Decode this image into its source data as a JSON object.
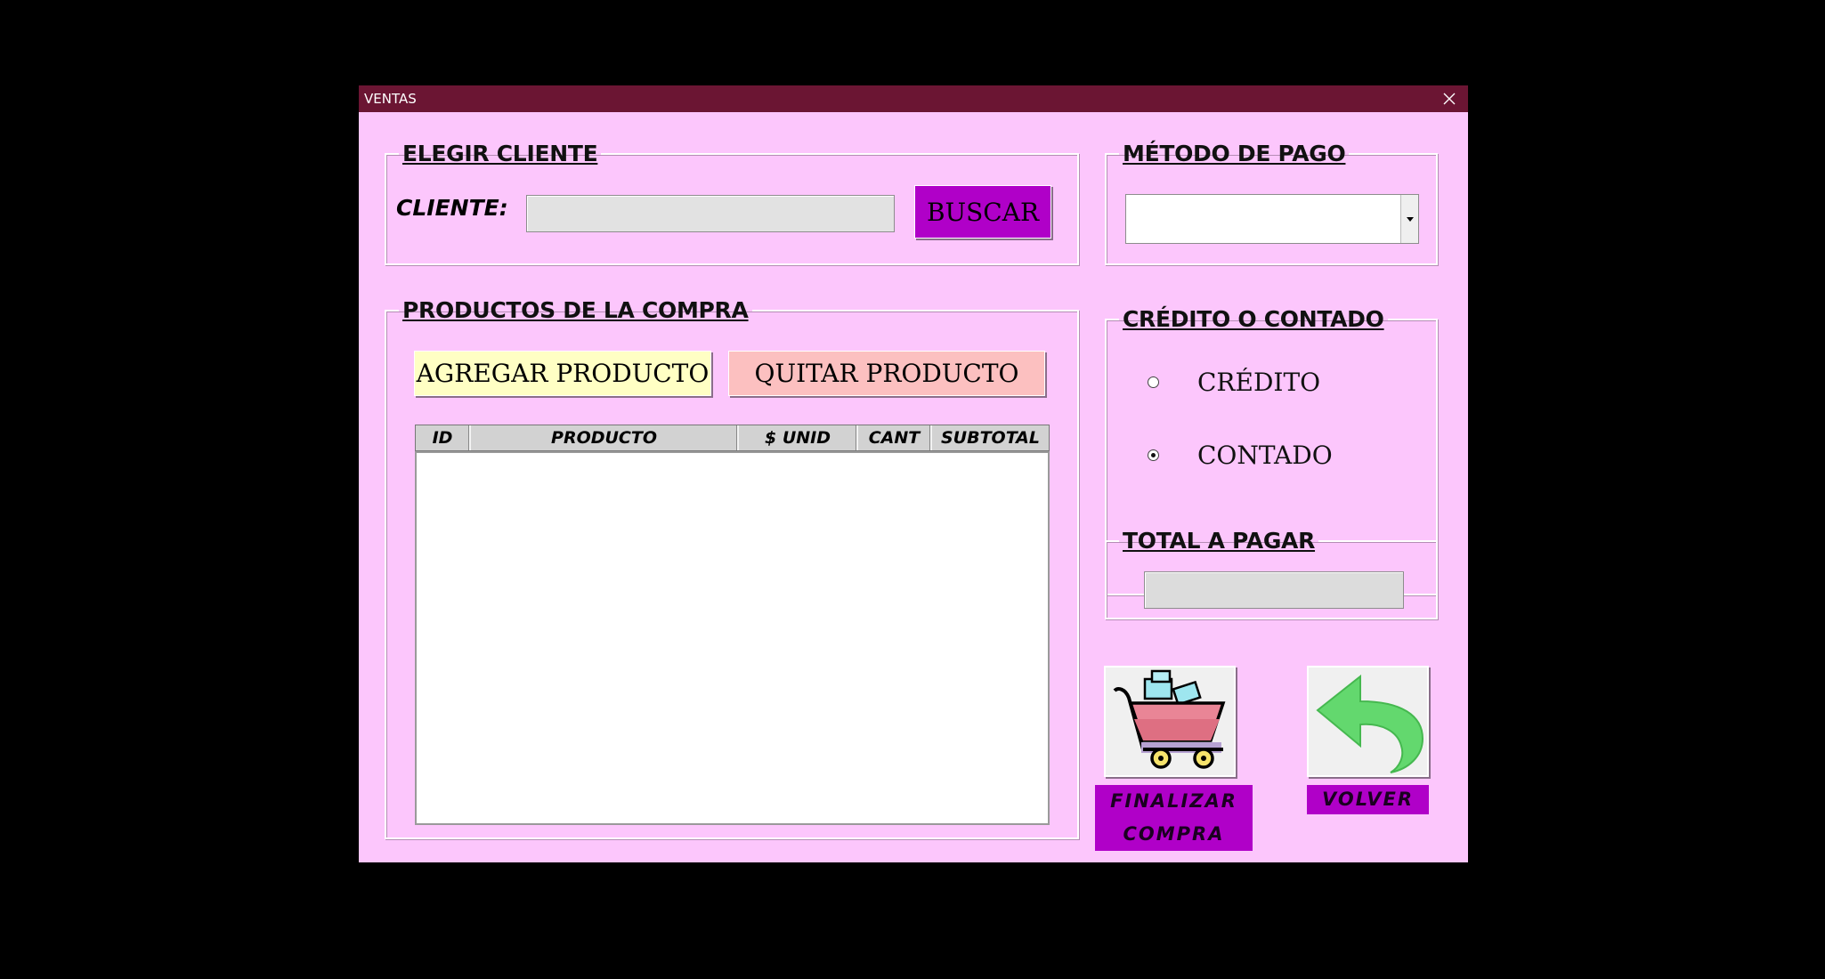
{
  "window": {
    "title": "VENTAS"
  },
  "cliente_frame": {
    "legend": "ELEGIR CLIENTE",
    "label": "CLIENTE:",
    "input_value": "",
    "buscar_label": "BUSCAR"
  },
  "pago_frame": {
    "legend": "MÉTODO DE PAGO",
    "selected": ""
  },
  "productos_frame": {
    "legend": "PRODUCTOS DE LA COMPRA",
    "agregar_label": "AGREGAR PRODUCTO",
    "quitar_label": "QUITAR PRODUCTO",
    "columns": [
      "ID",
      "PRODUCTO",
      "$ UNID",
      "CANT",
      "SUBTOTAL"
    ],
    "rows": []
  },
  "credito_frame": {
    "legend": "CRÉDITO O CONTADO",
    "options": [
      {
        "label": "CRÉDITO",
        "checked": false
      },
      {
        "label": "CONTADO",
        "checked": true
      }
    ]
  },
  "total_frame": {
    "legend": "TOTAL A PAGAR",
    "value": ""
  },
  "actions": {
    "finalizar_line1": "FINALIZAR",
    "finalizar_line2": "COMPRA",
    "volver_label": "VOLVER"
  },
  "colors": {
    "window_bg": "#fcc6fc",
    "titlebar": "#6b1533",
    "buscar_bg": "#b000c8",
    "agregar_bg": "#ffffc4",
    "quitar_bg": "#fcc0c0",
    "caption_bg": "#b000c8"
  }
}
